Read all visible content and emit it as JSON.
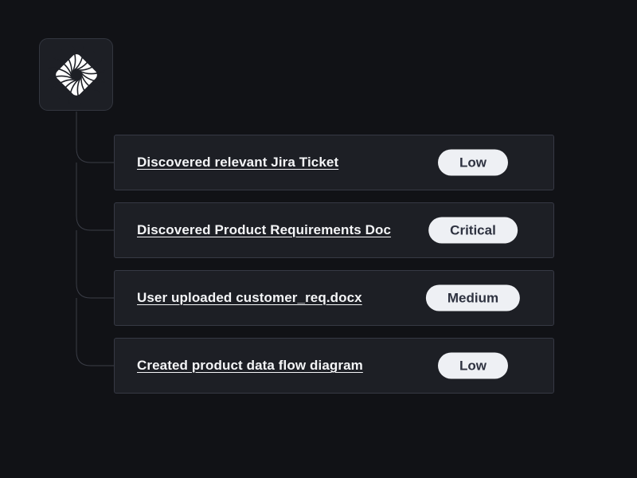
{
  "logo": {
    "icon": "swirl-logo-icon"
  },
  "activity_feed": {
    "items": [
      {
        "title": "Discovered relevant Jira Ticket",
        "priority": "Low"
      },
      {
        "title": "Discovered Product Requirements Doc",
        "priority": "Critical"
      },
      {
        "title": "User uploaded customer_req.docx",
        "priority": "Medium"
      },
      {
        "title": "Created product data flow diagram",
        "priority": "Low"
      }
    ]
  },
  "colors": {
    "background": "#111216",
    "card": "#1d1f25",
    "card_border": "#363944",
    "badge_bg": "#eef0f4",
    "badge_text": "#2e3240",
    "text": "#f4f5f7"
  }
}
